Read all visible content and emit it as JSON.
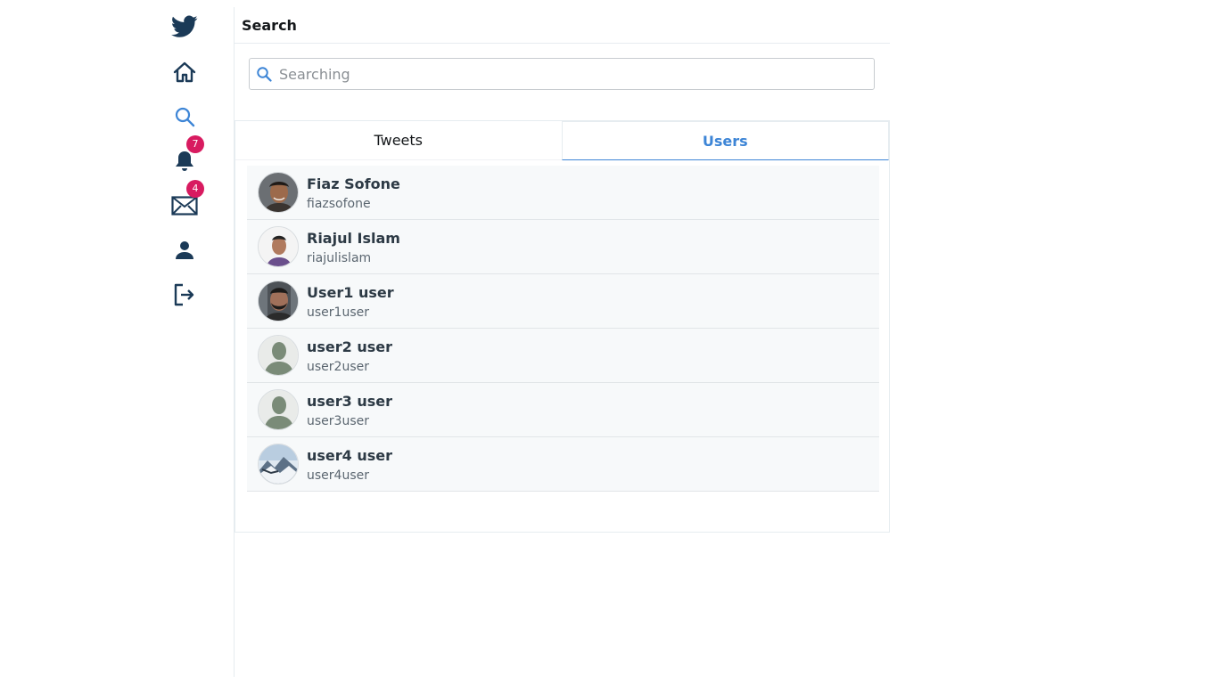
{
  "header": {
    "title": "Search"
  },
  "search": {
    "placeholder": "Searching",
    "value": ""
  },
  "nav": {
    "items": [
      {
        "name": "twitter-logo",
        "icon": "twitter-bird-icon"
      },
      {
        "name": "home",
        "icon": "home-icon"
      },
      {
        "name": "search",
        "icon": "search-icon"
      },
      {
        "name": "notifications",
        "icon": "bell-icon",
        "badge": "7"
      },
      {
        "name": "messages",
        "icon": "envelope-icon",
        "badge": "4"
      },
      {
        "name": "profile",
        "icon": "user-icon"
      },
      {
        "name": "logout",
        "icon": "logout-icon"
      }
    ],
    "colors": {
      "logo": "#1b3a57",
      "active": "#3d85d6",
      "badge": "#d81b60"
    }
  },
  "tabs": [
    {
      "label": "Tweets",
      "active": false
    },
    {
      "label": "Users",
      "active": true
    }
  ],
  "users": [
    {
      "name": "Fiaz Sofone",
      "handle": "fiazsofone",
      "avatar": "photo-avatar"
    },
    {
      "name": "Riajul Islam",
      "handle": "riajulislam",
      "avatar": "photo-avatar"
    },
    {
      "name": "User1 user",
      "handle": "user1user",
      "avatar": "photo-avatar"
    },
    {
      "name": "user2 user",
      "handle": "user2user",
      "avatar": "default-avatar"
    },
    {
      "name": "user3 user",
      "handle": "user3user",
      "avatar": "default-avatar"
    },
    {
      "name": "user4 user",
      "handle": "user4user",
      "avatar": "landscape-avatar"
    }
  ]
}
